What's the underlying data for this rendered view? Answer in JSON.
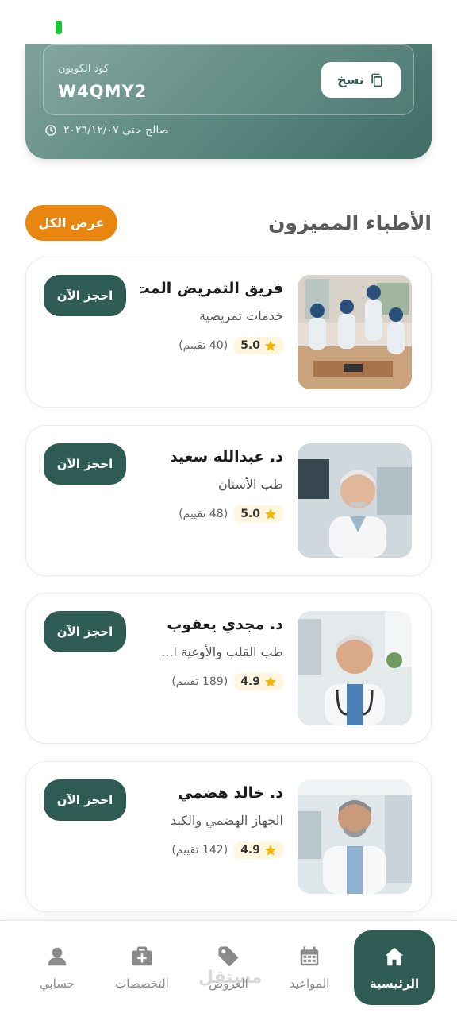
{
  "coupon": {
    "label": "كود الكوبون",
    "code": "W4QMY2",
    "copy_label": "نسخ",
    "validity": "صالح حتى ٢٠٢٦/١٢/٠٧"
  },
  "featured": {
    "title": "الأطباء المميزون",
    "view_all_label": "عرض الكل"
  },
  "doctors": [
    {
      "name": "فريق التمريض المت...",
      "specialty": "خدمات تمريضية",
      "rating": "5.0",
      "reviews": "(40 تقييم)",
      "book_label": "احجز الآن"
    },
    {
      "name": "د. عبدالله سعيد",
      "specialty": "طب الأسنان",
      "rating": "5.0",
      "reviews": "(48 تقييم)",
      "book_label": "احجز الآن"
    },
    {
      "name": "د. مجدي يعقوب",
      "specialty": "طب القلب والأوعية ا...",
      "rating": "4.9",
      "reviews": "(189 تقييم)",
      "book_label": "احجز الآن"
    },
    {
      "name": "د. خالد هضمي",
      "specialty": "الجهاز الهضمي والكبد",
      "rating": "4.9",
      "reviews": "(142 تقييم)",
      "book_label": "احجز الآن"
    }
  ],
  "nav": {
    "home": "الرئيسية",
    "appointments": "المواعيد",
    "offers": "العروض",
    "specialties": "التخصصات",
    "account": "حسابي"
  },
  "watermark": "مستقل",
  "colors": {
    "primary": "#2f5b55",
    "accent": "#e8860f",
    "star": "#f5b400"
  },
  "icons": [
    "copy-icon",
    "clock-icon",
    "star-icon",
    "home-icon",
    "calendar-icon",
    "tag-icon",
    "medical-kit-icon",
    "person-icon"
  ]
}
